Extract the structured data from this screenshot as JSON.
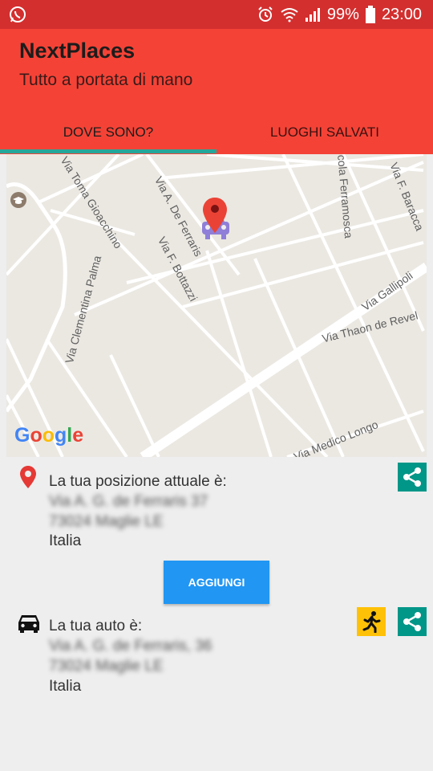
{
  "status_bar": {
    "battery": "99%",
    "time": "23:00",
    "icons": [
      "whatsapp-icon",
      "alarm-icon",
      "wifi-icon",
      "signal-icon",
      "battery-icon"
    ]
  },
  "app": {
    "title": "NextPlaces",
    "subtitle": "Tutto a portata di mano",
    "accent_color": "#f44336",
    "status_color": "#d32f2f",
    "indicator_color": "#26a69a"
  },
  "tabs": [
    {
      "label": "DOVE SONO?",
      "active": true
    },
    {
      "label": "LUOGHI SALVATI",
      "active": false
    }
  ],
  "map": {
    "streets": [
      "Via Toma Gioacchino",
      "Via A. De Ferraris",
      "Via F. Bottazzi",
      "Via Clementina Palma",
      "cola Ferramosca",
      "Via F. Baracca",
      "Via Gallipoli",
      "Via Thaon de Revel",
      "Via Medico Longo"
    ],
    "logo": [
      "G",
      "o",
      "o",
      "g",
      "l",
      "e"
    ],
    "markers": [
      "location-pin-icon",
      "car-icon",
      "school-icon"
    ]
  },
  "current_position": {
    "label": "La tua posizione attuale è:",
    "address_line1": "Via A. G. de Ferraris 37",
    "address_line2": "73024 Maglie LE",
    "country": "Italia"
  },
  "add_button": "AGGIUNGI",
  "car": {
    "label": "La tua auto è:",
    "address_line1": "Via A. G. de Ferraris, 36",
    "address_line2": "73024 Maglie LE",
    "country": "Italia"
  }
}
